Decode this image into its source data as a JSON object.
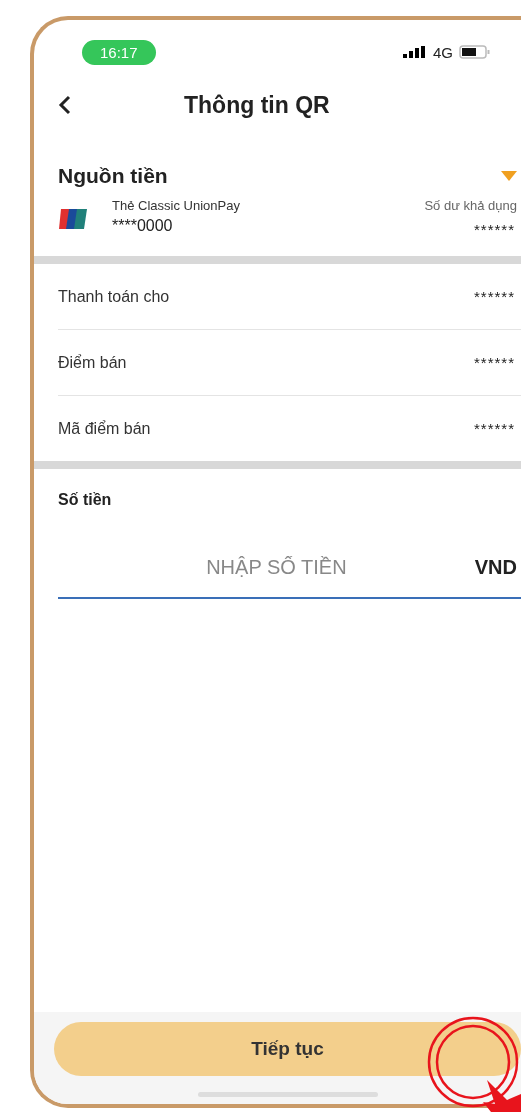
{
  "status_bar": {
    "time": "16:17",
    "network": "4G"
  },
  "header": {
    "title": "Thông tin QR"
  },
  "source": {
    "label": "Nguồn tiền",
    "card_name": "Thẻ Classic UnionPay",
    "card_number": "****0000",
    "balance_label": "Số dư khả dụng",
    "balance_value": "******"
  },
  "rows": [
    {
      "label": "Thanh toán cho",
      "value": "******"
    },
    {
      "label": "Điểm bán",
      "value": "******"
    },
    {
      "label": "Mã điểm bán",
      "value": "******"
    }
  ],
  "amount": {
    "label": "Số tiền",
    "placeholder": "NHẬP SỐ TIỀN",
    "currency": "VND"
  },
  "button": {
    "label": "Tiếp tục"
  }
}
